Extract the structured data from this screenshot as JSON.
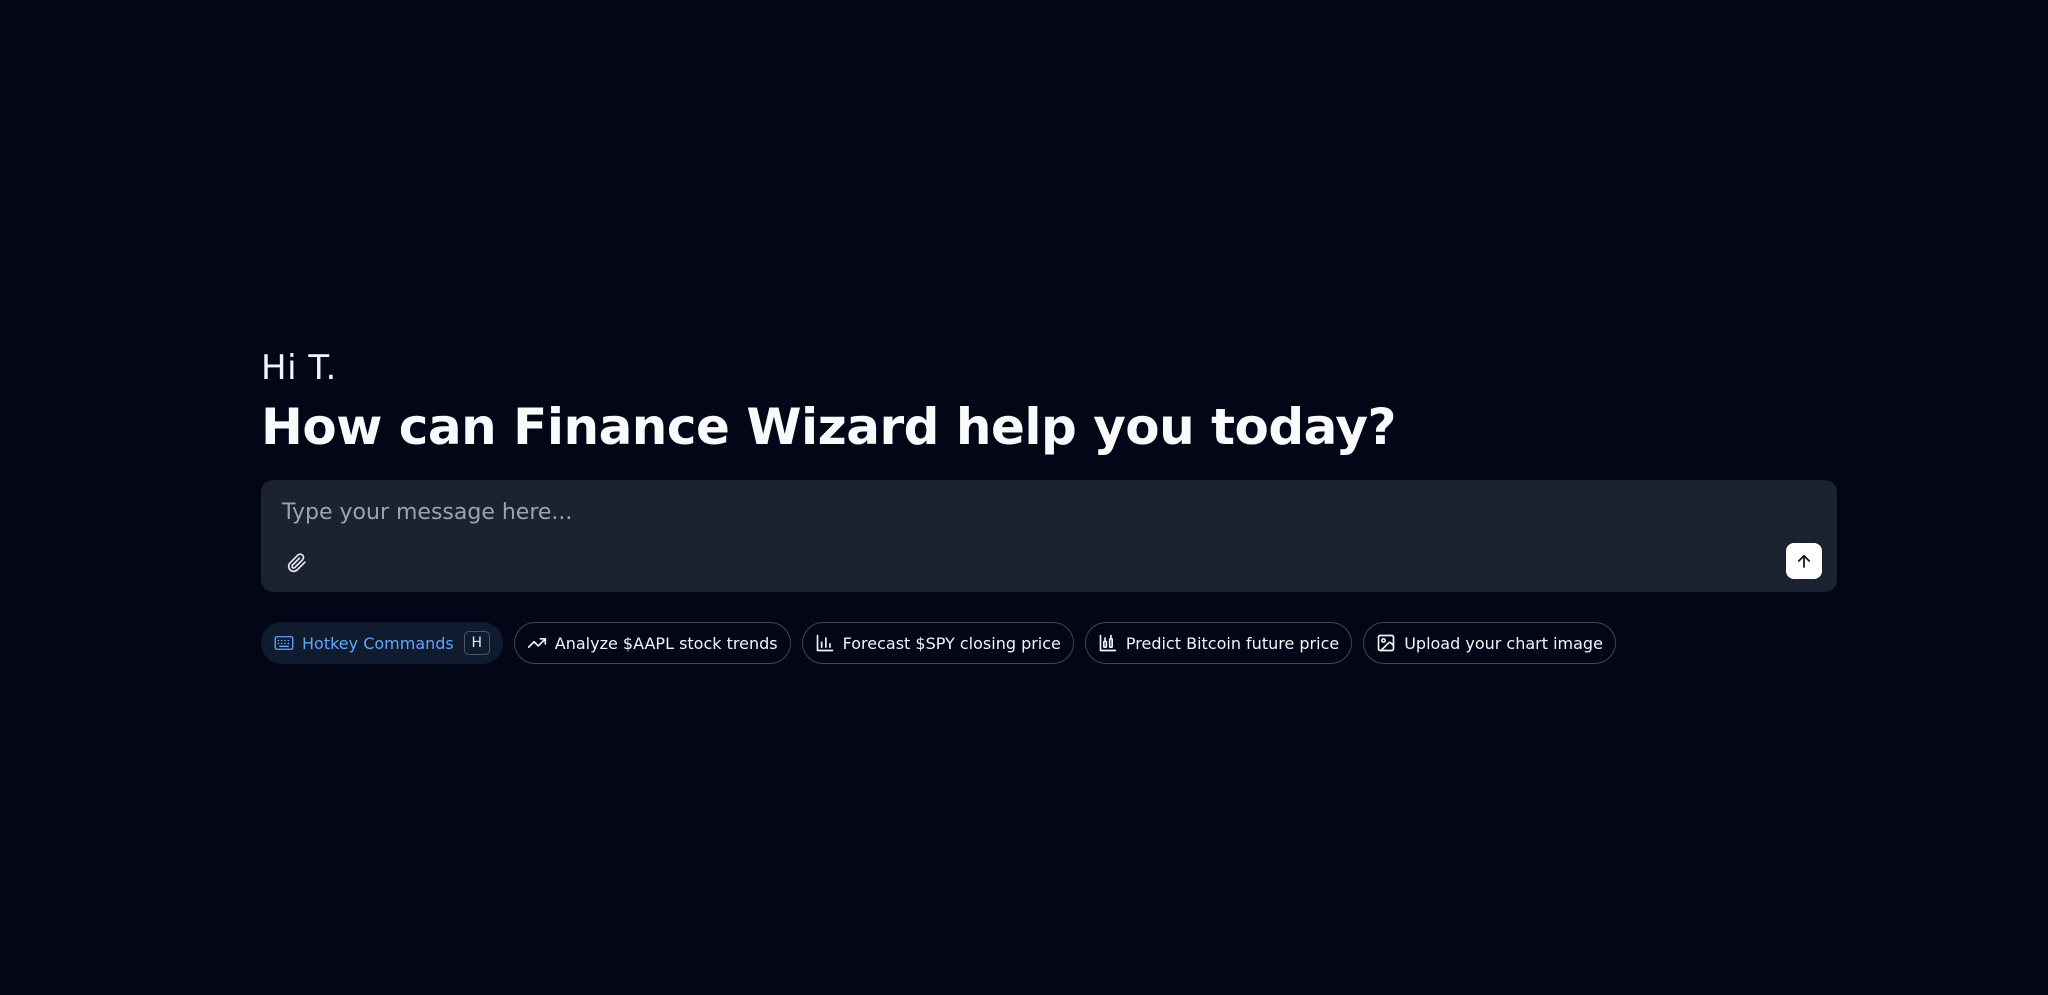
{
  "greeting": "Hi T.",
  "headline": "How can Finance Wizard help you today?",
  "composer": {
    "placeholder": "Type your message here...",
    "value": ""
  },
  "chips": {
    "hotkey": {
      "label": "Hotkey Commands",
      "key": "H"
    },
    "items": [
      {
        "label": "Analyze $AAPL stock trends",
        "icon": "trending-up-icon"
      },
      {
        "label": "Forecast $SPY closing price",
        "icon": "bar-chart-icon"
      },
      {
        "label": "Predict Bitcoin future price",
        "icon": "chart-analytics-icon"
      },
      {
        "label": "Upload your chart image",
        "icon": "image-icon"
      }
    ]
  },
  "colors": {
    "background": "#020617",
    "composer": "#1b2333",
    "accent": "#60a5fa"
  }
}
